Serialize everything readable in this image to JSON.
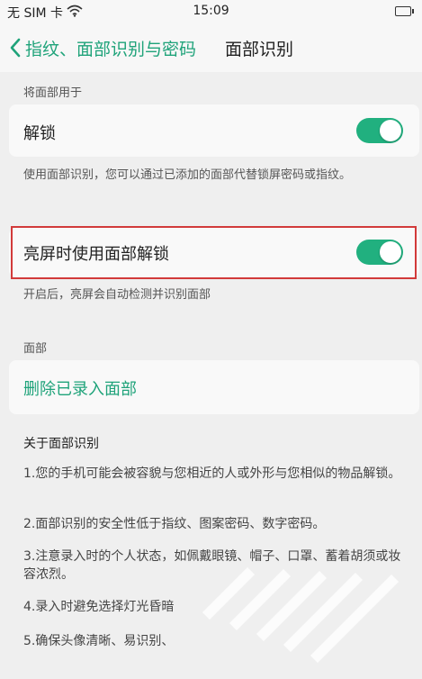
{
  "status_bar": {
    "carrier": "无 SIM 卡",
    "time": "15:09"
  },
  "header": {
    "back_label": "指纹、面部识别与密码",
    "title": "面部识别"
  },
  "section_use": {
    "label": "将面部用于",
    "unlock_label": "解锁",
    "unlock_on": true,
    "unlock_desc": "使用面部识别，您可以通过已添加的面部代替锁屏密码或指纹。"
  },
  "screen_on": {
    "label": "亮屏时使用面部解锁",
    "on": true,
    "desc": "开启后，亮屏会自动检测并识别面部"
  },
  "section_face": {
    "label": "面部",
    "delete_label": "删除已录入面部"
  },
  "about": {
    "title": "关于面部识别",
    "items": [
      "1.您的手机可能会被容貌与您相近的人或外形与您相似的物品解锁。",
      "2.面部识别的安全性低于指纹、图案密码、数字密码。",
      "3.注意录入时的个人状态，如佩戴眼镜、帽子、口罩、蓄着胡须或妆容浓烈。",
      "4.录入时避免选择灯光昏暗",
      "5.确保头像清晰、易识别、"
    ]
  },
  "colors": {
    "accent": "#1fa37a",
    "toggle_on": "#21b07f",
    "highlight": "#d23a3a"
  }
}
